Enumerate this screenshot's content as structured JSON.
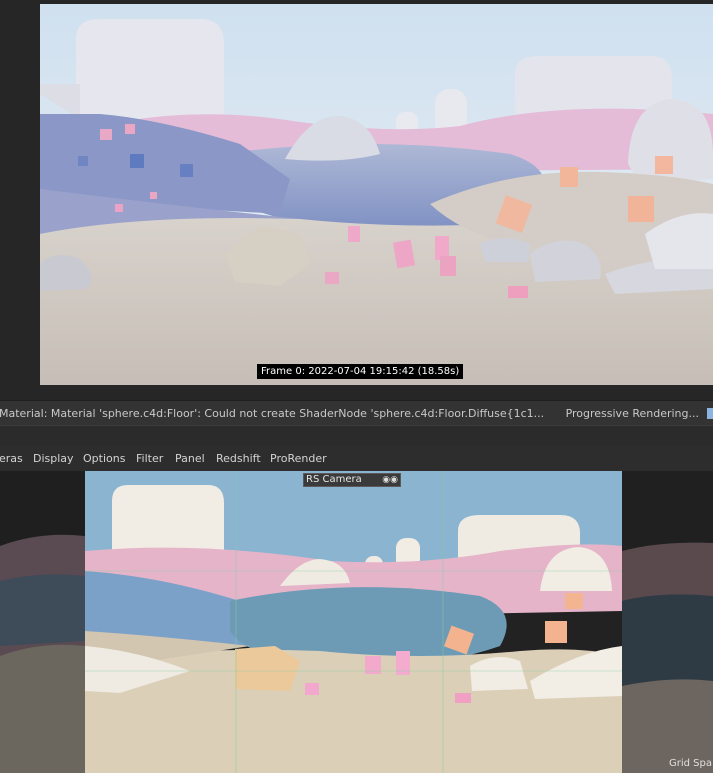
{
  "render_view": {
    "frame_info": "Frame  0:  2022-07-04  19:15:42  (18.58s)"
  },
  "status_bar": {
    "message": "Material: Material 'sphere.c4d:Floor': Could not create ShaderNode 'sphere.c4d:Floor.Diffuse{1c1...",
    "progress_text": "Progressive Rendering..."
  },
  "menu": {
    "items": [
      "eras",
      "Display",
      "Options",
      "Filter",
      "Panel",
      "Redshift",
      "ProRender"
    ]
  },
  "viewport": {
    "camera_label": "RS Camera",
    "grid_label": "Grid Spa"
  },
  "icons": {
    "camera": "camera-icon"
  },
  "colors": {
    "viewport_sky": "#8ab4cf",
    "viewport_ground": "#dccfb8",
    "progress_accent": "#8db4e0"
  }
}
